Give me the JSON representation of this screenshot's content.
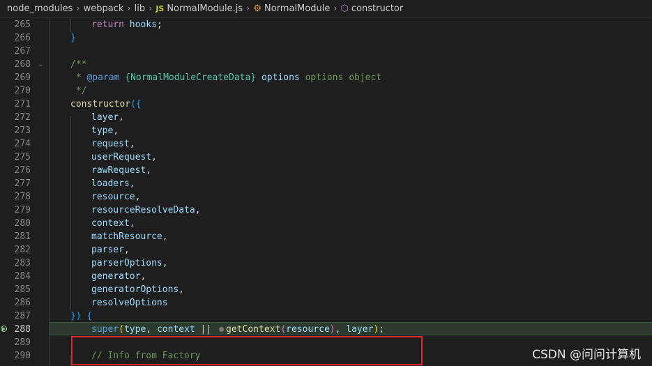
{
  "breadcrumb": {
    "items": [
      "node_modules",
      "webpack",
      "lib",
      "NormalModule.js",
      "NormalModule",
      "constructor"
    ],
    "js_badge": "JS"
  },
  "editor": {
    "lines": [
      {
        "num": "265",
        "code": [
          [
            "kw",
            "return "
          ],
          [
            "var",
            "hooks"
          ],
          [
            "pn",
            ";"
          ]
        ]
      },
      {
        "num": "266",
        "code": [
          [
            "br3",
            "}"
          ]
        ]
      },
      {
        "num": "267",
        "code": []
      },
      {
        "num": "268",
        "code": [
          [
            "cm",
            "/**"
          ]
        ]
      },
      {
        "num": "269",
        "code": [
          [
            "cm",
            " * "
          ],
          [
            "bl",
            "@param"
          ],
          [
            "cm",
            " "
          ],
          [
            "tp",
            "{NormalModuleCreateData}"
          ],
          [
            "cm",
            " "
          ],
          [
            "var",
            "options"
          ],
          [
            "cm",
            " options object"
          ]
        ]
      },
      {
        "num": "270",
        "code": [
          [
            "cm",
            " */"
          ]
        ]
      },
      {
        "num": "271",
        "code": [
          [
            "fn",
            "constructor"
          ],
          [
            "br3",
            "({"
          ]
        ]
      },
      {
        "num": "272",
        "code": [
          [
            "var",
            "layer"
          ],
          [
            "pn",
            ","
          ]
        ]
      },
      {
        "num": "273",
        "code": [
          [
            "var",
            "type"
          ],
          [
            "pn",
            ","
          ]
        ]
      },
      {
        "num": "274",
        "code": [
          [
            "var",
            "request"
          ],
          [
            "pn",
            ","
          ]
        ]
      },
      {
        "num": "275",
        "code": [
          [
            "var",
            "userRequest"
          ],
          [
            "pn",
            ","
          ]
        ]
      },
      {
        "num": "276",
        "code": [
          [
            "var",
            "rawRequest"
          ],
          [
            "pn",
            ","
          ]
        ]
      },
      {
        "num": "277",
        "code": [
          [
            "var",
            "loaders"
          ],
          [
            "pn",
            ","
          ]
        ]
      },
      {
        "num": "278",
        "code": [
          [
            "var",
            "resource"
          ],
          [
            "pn",
            ","
          ]
        ]
      },
      {
        "num": "279",
        "code": [
          [
            "var",
            "resourceResolveData"
          ],
          [
            "pn",
            ","
          ]
        ]
      },
      {
        "num": "280",
        "code": [
          [
            "var",
            "context"
          ],
          [
            "pn",
            ","
          ]
        ]
      },
      {
        "num": "281",
        "code": [
          [
            "var",
            "matchResource"
          ],
          [
            "pn",
            ","
          ]
        ]
      },
      {
        "num": "282",
        "code": [
          [
            "var",
            "parser"
          ],
          [
            "pn",
            ","
          ]
        ]
      },
      {
        "num": "283",
        "code": [
          [
            "var",
            "parserOptions"
          ],
          [
            "pn",
            ","
          ]
        ]
      },
      {
        "num": "284",
        "code": [
          [
            "var",
            "generator"
          ],
          [
            "pn",
            ","
          ]
        ]
      },
      {
        "num": "285",
        "code": [
          [
            "var",
            "generatorOptions"
          ],
          [
            "pn",
            ","
          ]
        ]
      },
      {
        "num": "286",
        "code": [
          [
            "var",
            "resolveOptions"
          ]
        ]
      },
      {
        "num": "287",
        "code": [
          [
            "br3",
            "})"
          ],
          [
            "pn",
            " "
          ],
          [
            "br3",
            "{"
          ]
        ]
      },
      {
        "num": "288",
        "code": [
          [
            "bl",
            "super"
          ],
          [
            "br2",
            "("
          ],
          [
            "var",
            "type"
          ],
          [
            "pn",
            ", "
          ],
          [
            "var",
            "context"
          ],
          [
            "pn",
            " || "
          ],
          [
            "dot",
            ""
          ],
          [
            "fn",
            "getContext"
          ],
          [
            "br1",
            "("
          ],
          [
            "var",
            "resource"
          ],
          [
            "br1",
            ")"
          ],
          [
            "pn",
            ", "
          ],
          [
            "var",
            "layer"
          ],
          [
            "br2",
            ")"
          ],
          [
            "pn",
            ";"
          ]
        ]
      },
      {
        "num": "289",
        "code": []
      },
      {
        "num": "290",
        "code": [
          [
            "cm",
            "// Info from Factory"
          ]
        ]
      }
    ]
  },
  "watermark": "CSDN @问问计算机"
}
